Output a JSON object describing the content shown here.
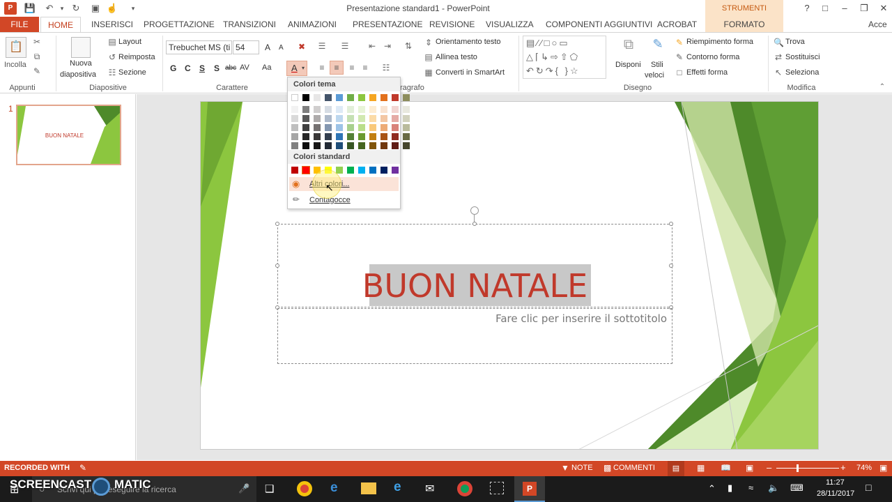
{
  "window": {
    "title": "Presentazione standard1 - PowerPoint",
    "context_header": "STRUMENTI DISEGNO",
    "account": "Acce"
  },
  "tabs": {
    "file": "FILE",
    "home": "HOME",
    "inserisci": "INSERISCI",
    "progettazione": "PROGETTAZIONE",
    "transizioni": "TRANSIZIONI",
    "animazioni": "ANIMAZIONI",
    "presentazione": "PRESENTAZIONE",
    "revisione": "REVISIONE",
    "visualizza": "VISUALIZZA",
    "componenti": "COMPONENTI AGGIUNTIVI",
    "acrobat": "ACROBAT",
    "formato": "FORMATO"
  },
  "ribbon": {
    "appunti": {
      "label": "Appunti",
      "incolla": "Incolla"
    },
    "diapositive": {
      "label": "Diapositive",
      "nuova_1": "Nuova",
      "nuova_2": "diapositiva",
      "layout": "Layout",
      "reimposta": "Reimposta",
      "sezione": "Sezione"
    },
    "carattere": {
      "label": "Carattere",
      "font": "Trebuchet MS (ti",
      "size": "54",
      "bold": "G",
      "italic": "C",
      "underline": "S",
      "shadow": "S",
      "strike": "abc",
      "spacing": "AV",
      "case": "Aa",
      "grow": "A",
      "shrink": "A"
    },
    "paragrafo": {
      "label": "ragrafo",
      "orientamento": "Orientamento testo",
      "allinea": "Allinea testo",
      "converti": "Converti in SmartArt"
    },
    "disegno": {
      "label": "Disegno",
      "disponi": "Disponi",
      "stili_1": "Stili",
      "stili_2": "veloci",
      "riempimento": "Riempimento forma",
      "contorno": "Contorno forma",
      "effetti": "Effetti forma"
    },
    "modifica": {
      "label": "Modifica",
      "trova": "Trova",
      "sostituisci": "Sostituisci",
      "seleziona": "Seleziona"
    }
  },
  "thumbnails": {
    "number": "1",
    "title": "BUON NATALE"
  },
  "slide": {
    "title": "BUON NATALE",
    "subtitle_placeholder": "Fare clic per inserire il sottotitolo"
  },
  "color_dropdown": {
    "theme_header": "Colori tema",
    "standard_header": "Colori standard",
    "more_colors": "Altri colori...",
    "eyedropper": "Contagocce",
    "theme_top": [
      "#ffffff",
      "#000000",
      "#e7e6e6",
      "#44546a",
      "#5b9bd5",
      "#70ad47",
      "#8cc63f",
      "#f5a623",
      "#e2711d",
      "#c0392b",
      "#8d8d5c"
    ],
    "theme_columns": [
      [
        "#f2f2f2",
        "#d9d9d9",
        "#bfbfbf",
        "#a6a6a6",
        "#808080"
      ],
      [
        "#7f7f7f",
        "#595959",
        "#404040",
        "#262626",
        "#0d0d0d"
      ],
      [
        "#d0cece",
        "#aeabab",
        "#757171",
        "#3a3838",
        "#171616"
      ],
      [
        "#d6dce4",
        "#adb9ca",
        "#8497b0",
        "#333f4f",
        "#222a35"
      ],
      [
        "#deeaf6",
        "#bdd7ee",
        "#9dc3e6",
        "#2e75b5",
        "#1f4e79"
      ],
      [
        "#e2efd9",
        "#c5e0b3",
        "#a8d08d",
        "#538135",
        "#375623"
      ],
      [
        "#e8f4d8",
        "#d1e9b1",
        "#bade8a",
        "#6a9a2f",
        "#46661f"
      ],
      [
        "#fdedd3",
        "#fbdba7",
        "#f9c97b",
        "#c27f10",
        "#81550a"
      ],
      [
        "#f9e3d1",
        "#f3c7a4",
        "#edab76",
        "#a95415",
        "#71380e"
      ],
      [
        "#f2d5d2",
        "#e5aba6",
        "#d9827a",
        "#902b20",
        "#601c15"
      ],
      [
        "#e8e8de",
        "#d1d1bd",
        "#babb9c",
        "#696a44",
        "#46462d"
      ]
    ],
    "standard": [
      "#c00000",
      "#ff0000",
      "#ffc000",
      "#ffff00",
      "#92d050",
      "#00b050",
      "#00b0f0",
      "#0070c0",
      "#002060",
      "#7030a0"
    ]
  },
  "statusbar": {
    "recorded": "RECORDED WITH",
    "note": "NOTE",
    "commenti": "COMMENTI",
    "zoom": "74%"
  },
  "taskbar": {
    "watermark": "SCREENCAST",
    "watermark_2": "MATIC",
    "search_placeholder": "Scrivi qui per eseguire la ricerca",
    "time": "11:27",
    "date": "28/11/2017"
  },
  "colors": {
    "accent": "#d24726",
    "title_red": "#c0392b",
    "green_dark": "#4e8a2a",
    "green_light": "#8cc63f"
  }
}
